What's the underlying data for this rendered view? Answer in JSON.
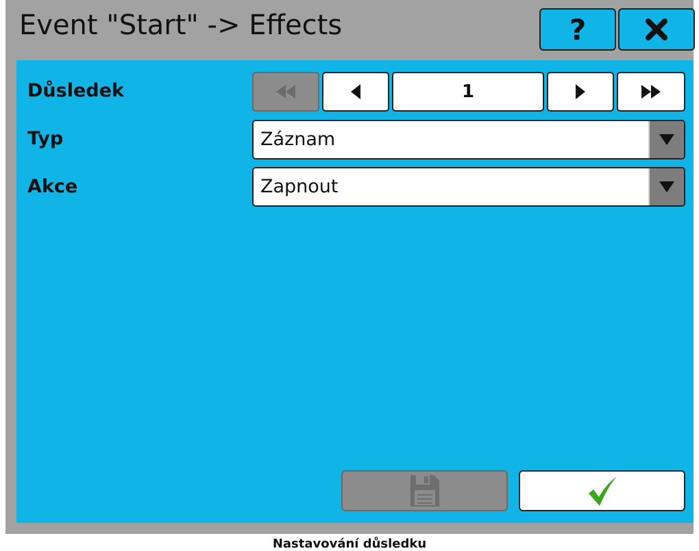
{
  "header": {
    "title": "Event \"Start\" -> Effects",
    "help_label": "?",
    "close_icon": "close-icon"
  },
  "form": {
    "consequence": {
      "label": "Důsledek",
      "value": "1"
    },
    "type": {
      "label": "Typ",
      "value": "Záznam"
    },
    "action": {
      "label": "Akce",
      "value": "Zapnout"
    }
  },
  "footer": {
    "save_icon": "save-icon",
    "confirm_icon": "checkmark-icon"
  },
  "caption": "Nastavování důsledku",
  "colors": {
    "panel": "#11b4e6",
    "frame": "#a3a2a2",
    "disabled": "#8c8c8c",
    "check": "#3aa81a"
  }
}
